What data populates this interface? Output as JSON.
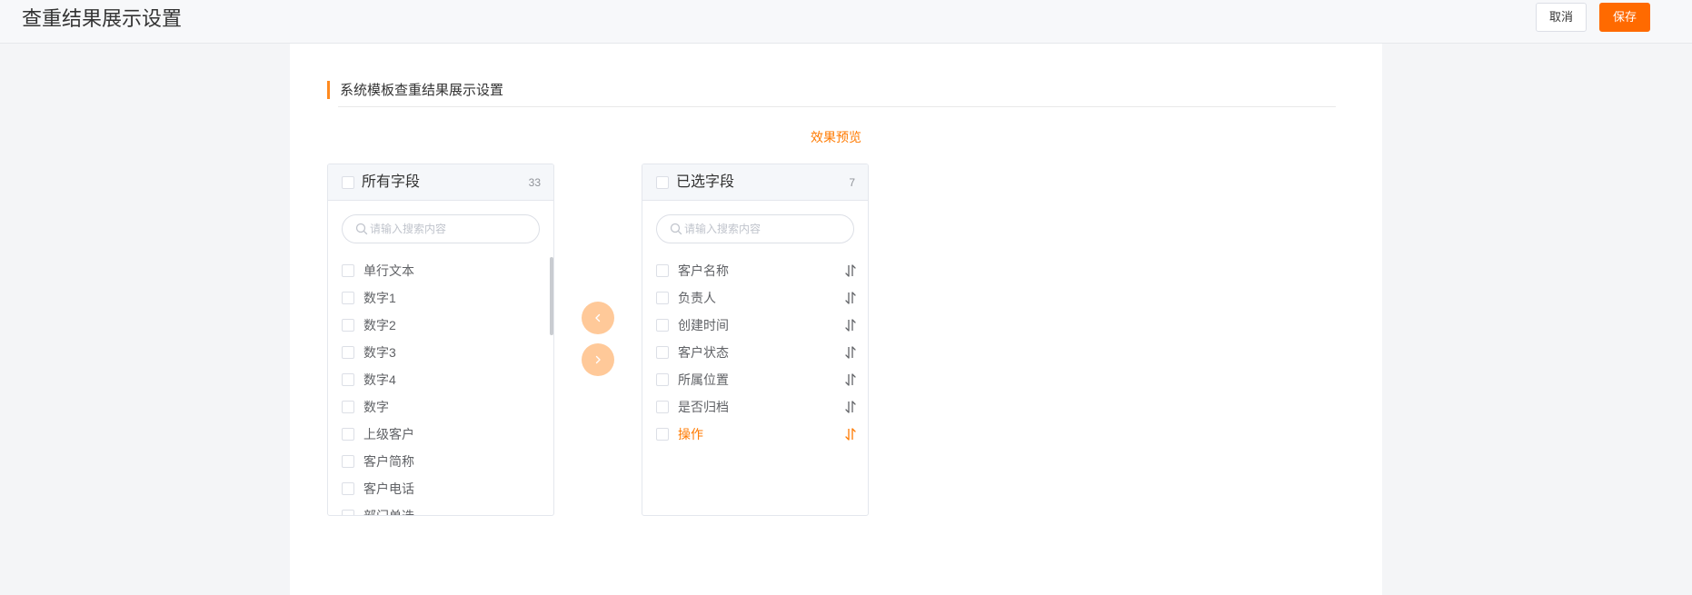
{
  "header": {
    "title": "查重结果展示设置",
    "cancel_label": "取消",
    "save_label": "保存"
  },
  "section": {
    "title": "系统模板查重结果展示设置"
  },
  "preview_link": "效果预览",
  "colors": {
    "accent": "#ff6a00",
    "accent_light": "#ffc999",
    "text_active": "#ff7a00"
  },
  "left_box": {
    "title": "所有字段",
    "count": "33",
    "search_placeholder": "请输入搜索内容",
    "items": [
      {
        "label": "单行文本"
      },
      {
        "label": "数字1"
      },
      {
        "label": "数字2"
      },
      {
        "label": "数字3"
      },
      {
        "label": "数字4"
      },
      {
        "label": "数字"
      },
      {
        "label": "上级客户"
      },
      {
        "label": "客户简称"
      },
      {
        "label": "客户电话"
      },
      {
        "label": "部门单选"
      }
    ]
  },
  "right_box": {
    "title": "已选字段",
    "count": "7",
    "search_placeholder": "请输入搜索内容",
    "items": [
      {
        "label": "客户名称"
      },
      {
        "label": "负责人"
      },
      {
        "label": "创建时间"
      },
      {
        "label": "客户状态"
      },
      {
        "label": "所属位置"
      },
      {
        "label": "是否归档"
      },
      {
        "label": "操作"
      }
    ]
  }
}
